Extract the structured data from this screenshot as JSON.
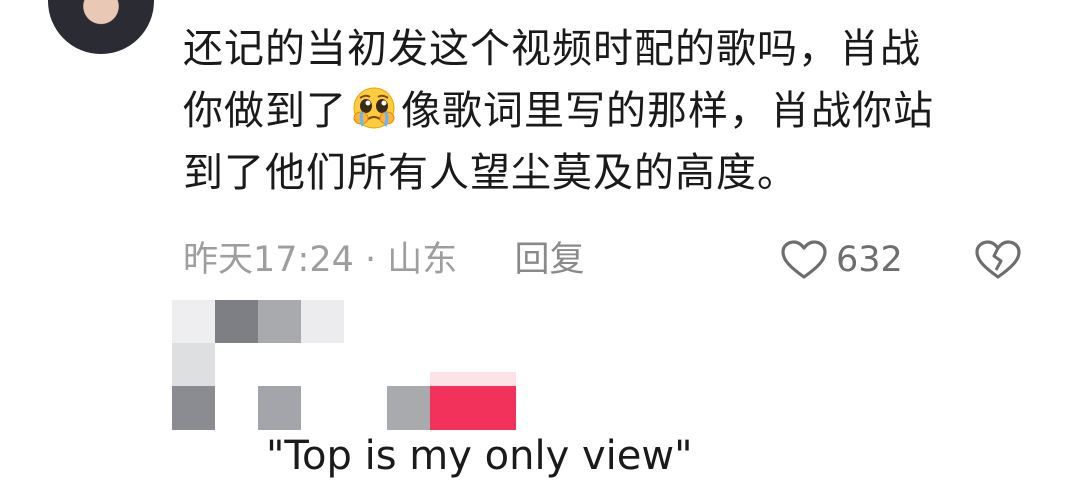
{
  "comment": {
    "text_lines": [
      "还记的当初发这个视频时配的歌吗，肖战",
      "你做到了",
      "像歌词里写的那样，肖战你站",
      "到了他们所有人望尘莫及的高度。"
    ],
    "emoji": "pleading-face-emoji",
    "time": "昨天17:24",
    "separator": "·",
    "location": "山东",
    "reply_label": "回复",
    "like_count": "632"
  },
  "quoted_text": "\"Top is my only view\"",
  "colors": {
    "text": "#1a1a1a",
    "meta": "#9e9e9e",
    "icon": "#6e6e6e",
    "mosaic_accent": "#f2325a"
  }
}
